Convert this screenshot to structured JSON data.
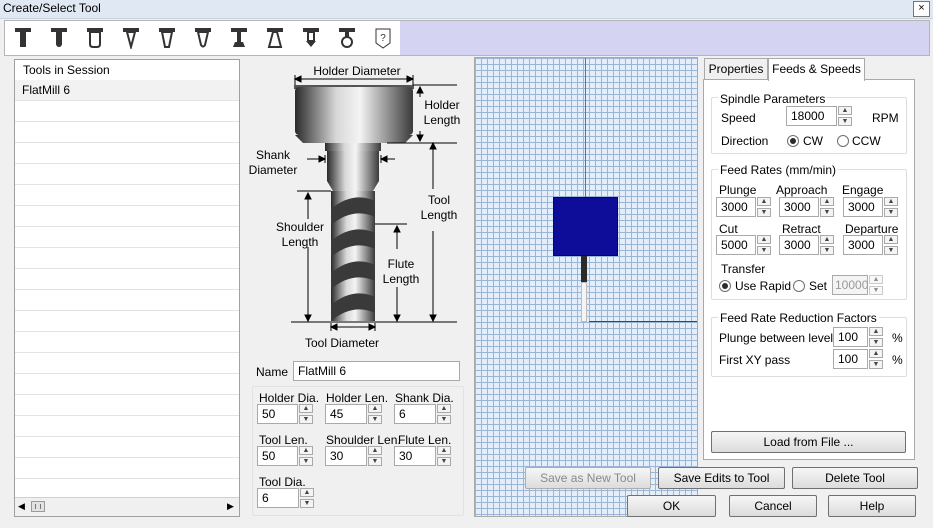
{
  "window": {
    "title": "Create/Select Tool",
    "close_glyph": "×"
  },
  "toolbar": {
    "icons": [
      "flat-mill-icon",
      "ball-mill-icon",
      "bull-nose-icon",
      "vee-cutter-icon",
      "taper-flat-icon",
      "taper-ball-icon",
      "dove-tail-icon",
      "lollipop-icon",
      "tap-icon",
      "form-tool-icon",
      "help-icon"
    ]
  },
  "tools_list": {
    "header": "Tools in Session",
    "items": [
      "FlatMill 6"
    ]
  },
  "diagram": {
    "holder_diameter": "Holder Diameter",
    "holder_length": "Holder Length",
    "shank_diameter": "Shank Diameter",
    "tool_length": "Tool Length",
    "shoulder_length": "Shoulder Length",
    "flute_length": "Flute Length",
    "tool_diameter": "Tool Diameter"
  },
  "name": {
    "label": "Name",
    "value": "FlatMill 6"
  },
  "dimensions": {
    "holder_dia": {
      "label": "Holder Dia.",
      "value": "50"
    },
    "holder_len": {
      "label": "Holder Len.",
      "value": "45"
    },
    "shank_dia": {
      "label": "Shank Dia.",
      "value": "6"
    },
    "tool_len": {
      "label": "Tool Len.",
      "value": "50"
    },
    "shoulder_len": {
      "label": "Shoulder Len.",
      "value": "30"
    },
    "flute_len": {
      "label": "Flute Len.",
      "value": "30"
    },
    "tool_dia": {
      "label": "Tool Dia.",
      "value": "6"
    }
  },
  "tabs": {
    "properties": "Properties",
    "feeds": "Feeds & Speeds"
  },
  "spindle": {
    "title": "Spindle Parameters",
    "speed_label": "Speed",
    "speed_value": "18000",
    "speed_unit": "RPM",
    "direction_label": "Direction",
    "cw": "CW",
    "ccw": "CCW",
    "selected": "CW"
  },
  "feed_rates": {
    "title": "Feed Rates (mm/min)",
    "plunge": {
      "label": "Plunge",
      "value": "3000"
    },
    "approach": {
      "label": "Approach",
      "value": "3000"
    },
    "engage": {
      "label": "Engage",
      "value": "3000"
    },
    "cut": {
      "label": "Cut",
      "value": "5000"
    },
    "retract": {
      "label": "Retract",
      "value": "3000"
    },
    "departure": {
      "label": "Departure",
      "value": "3000"
    },
    "transfer_label": "Transfer",
    "use_rapid": "Use Rapid",
    "set": "Set",
    "set_value": "10000",
    "selected": "Use Rapid"
  },
  "reduction": {
    "title": "Feed Rate Reduction Factors",
    "plunge_levels": {
      "label": "Plunge between levels",
      "value": "100",
      "unit": "%"
    },
    "first_xy": {
      "label": "First XY pass",
      "value": "100",
      "unit": "%"
    }
  },
  "buttons": {
    "load_from_file": "Load from File ...",
    "save_as_new": "Save as New Tool",
    "save_edits": "Save Edits to Tool",
    "delete": "Delete Tool",
    "ok": "OK",
    "cancel": "Cancel",
    "help": "Help"
  },
  "colors": {
    "tool_preview": "#0d0d9a",
    "axis_green": "#00c000",
    "axis_red": "#e00000",
    "toolbar_fill": "#d4d3f2"
  }
}
